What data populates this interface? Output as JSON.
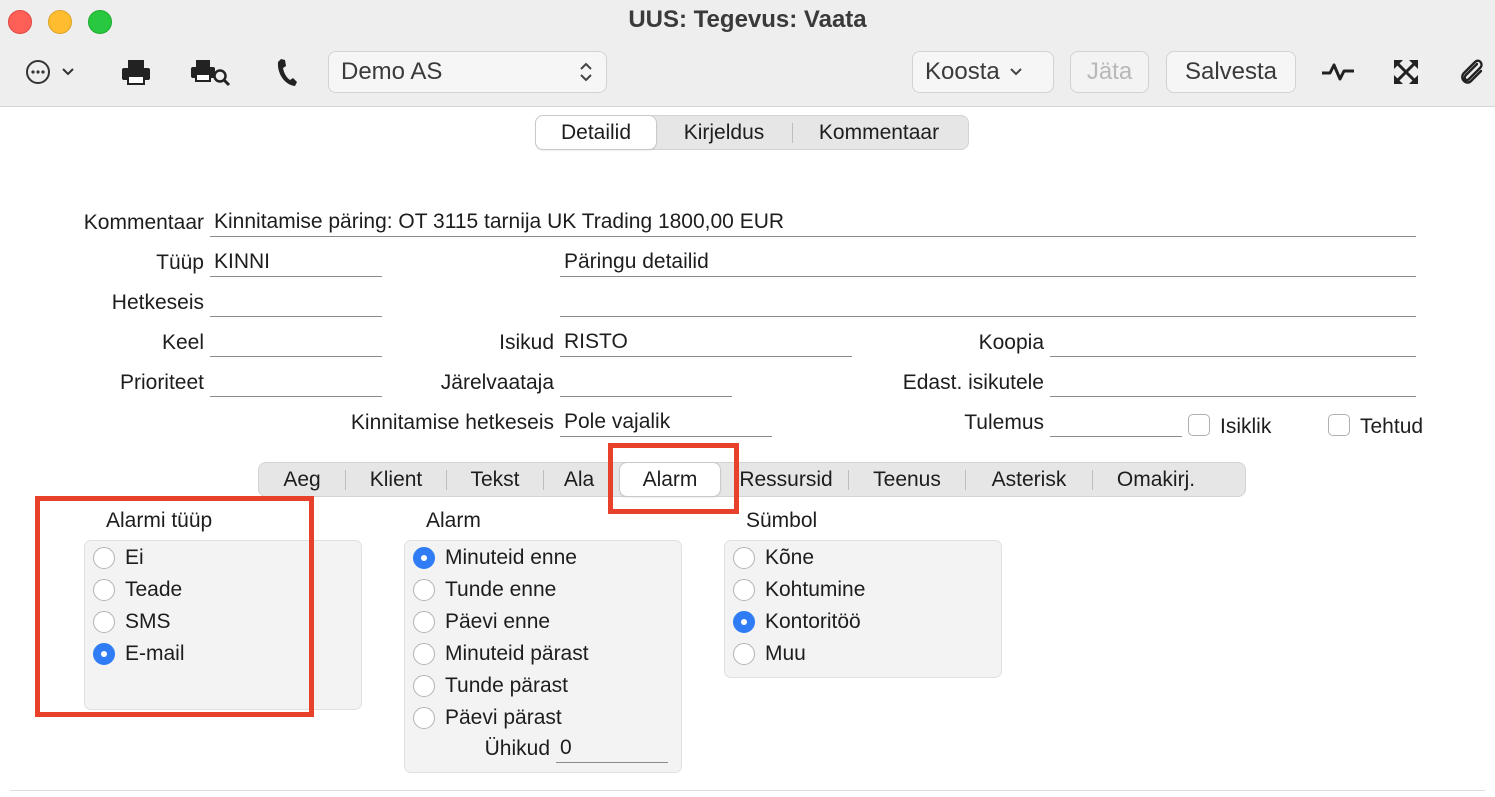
{
  "window": {
    "title": "UUS: Tegevus: Vaata"
  },
  "toolbar": {
    "company": "Demo AS",
    "koosta": "Koosta",
    "jata": "Jäta",
    "salvesta": "Salvesta"
  },
  "top_tabs": [
    "Detailid",
    "Kirjeldus",
    "Kommentaar"
  ],
  "form": {
    "kommentaar_label": "Kommentaar",
    "kommentaar_value": "Kinnitamise päring: OT 3115 tarnija UK Trading 1800,00 EUR",
    "tyyp_label": "Tüüp",
    "tyyp_value": "KINNI",
    "paringu_value": "Päringu detailid",
    "hetkeseis_label": "Hetkeseis",
    "hetkeseis_value": "",
    "keel_label": "Keel",
    "keel_value": "",
    "isikud_label": "Isikud",
    "isikud_value": "RISTO",
    "koopia_label": "Koopia",
    "koopia_value": "",
    "prioriteet_label": "Prioriteet",
    "prioriteet_value": "",
    "jarelvaataja_label": "Järelvaataja",
    "jarelvaataja_value": "",
    "edast_label": "Edast. isikutele",
    "edast_value": "",
    "kinnitamise_label": "Kinnitamise hetkeseis",
    "kinnitamise_value": "Pole vajalik",
    "tulemus_label": "Tulemus",
    "tulemus_value": "",
    "isiklik_label": "Isiklik",
    "isiklik_checked": false,
    "tehtud_label": "Tehtud",
    "tehtud_checked": false
  },
  "sub_tabs": [
    "Aeg",
    "Klient",
    "Tekst",
    "Ala",
    "Alarm",
    "Ressursid",
    "Teenus",
    "Asterisk",
    "Omakirj."
  ],
  "active_sub_tab": "Alarm",
  "alarm_type": {
    "title": "Alarmi tüüp",
    "options": [
      "Ei",
      "Teade",
      "SMS",
      "E-mail"
    ],
    "selected": "E-mail"
  },
  "alarm": {
    "title": "Alarm",
    "options": [
      "Minuteid enne",
      "Tunde enne",
      "Päevi enne",
      "Minuteid pärast",
      "Tunde pärast",
      "Päevi pärast"
    ],
    "selected": "Minuteid enne",
    "units_label": "Ühikud",
    "units_value": "0"
  },
  "symbol": {
    "title": "Sümbol",
    "options": [
      "Kõne",
      "Kohtumine",
      "Kontoritöö",
      "Muu"
    ],
    "selected": "Kontoritöö"
  },
  "colors": {
    "accent": "#2f7cf6",
    "highlight": "#e8412b"
  }
}
